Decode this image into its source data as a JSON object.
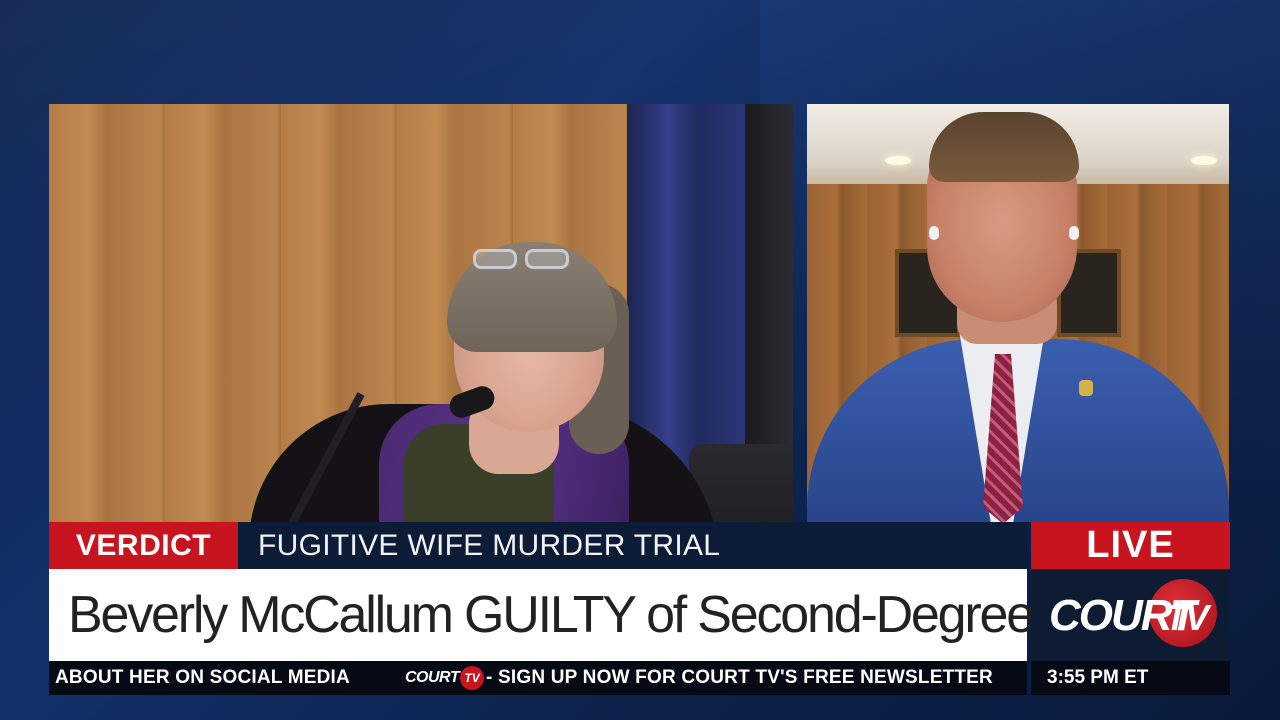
{
  "lower_third": {
    "tag": "VERDICT",
    "topic": "FUGITIVE WIFE MURDER TRIAL",
    "headline": "Beverly McCallum GUILTY of Second-Degree Murder",
    "live": "LIVE"
  },
  "logo": {
    "court": "COURT",
    "tv": "TV"
  },
  "ticker": {
    "segment_1": "ABOUT HER ON SOCIAL MEDIA",
    "logo_court": "COURT",
    "logo_tv": "TV",
    "segment_2": "- SIGN UP NOW FOR COURT TV'S FREE NEWSLETTER",
    "time": "3:55 PM ET"
  },
  "colors": {
    "accent_red": "#c8141e",
    "background_navy": "#0e2550",
    "ticker_black": "#050a14"
  }
}
